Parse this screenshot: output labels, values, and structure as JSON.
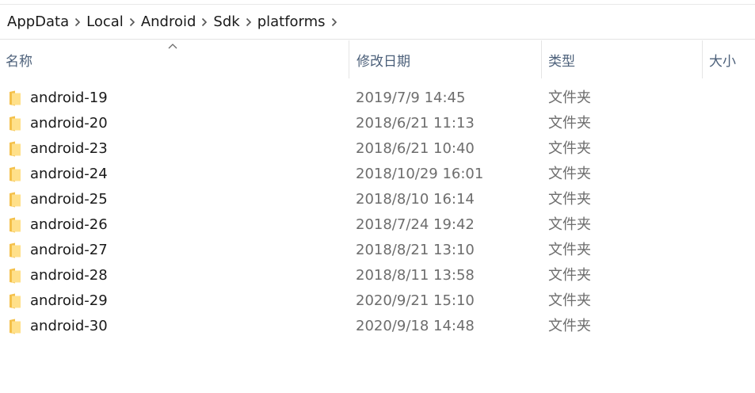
{
  "breadcrumb": {
    "items": [
      "AppData",
      "Local",
      "Android",
      "Sdk",
      "platforms"
    ],
    "separator_icon": "chevron-right-icon"
  },
  "columns": {
    "name": "名称",
    "date": "修改日期",
    "type": "类型",
    "size": "大小",
    "sort_indicator_icon": "sort-ascending-icon"
  },
  "files": [
    {
      "name": "android-19",
      "date": "2019/7/9 14:45",
      "type": "文件夹"
    },
    {
      "name": "android-20",
      "date": "2018/6/21 11:13",
      "type": "文件夹"
    },
    {
      "name": "android-23",
      "date": "2018/6/21 10:40",
      "type": "文件夹"
    },
    {
      "name": "android-24",
      "date": "2018/10/29 16:01",
      "type": "文件夹"
    },
    {
      "name": "android-25",
      "date": "2018/8/10 16:14",
      "type": "文件夹"
    },
    {
      "name": "android-26",
      "date": "2018/7/24 19:42",
      "type": "文件夹"
    },
    {
      "name": "android-27",
      "date": "2018/8/21 13:10",
      "type": "文件夹"
    },
    {
      "name": "android-28",
      "date": "2018/8/11 13:58",
      "type": "文件夹"
    },
    {
      "name": "android-29",
      "date": "2020/9/21 15:10",
      "type": "文件夹"
    },
    {
      "name": "android-30",
      "date": "2020/9/18 14:48",
      "type": "文件夹"
    }
  ],
  "colors": {
    "folder_light": "#ffe08a",
    "folder_dark": "#f4c04a",
    "header_text": "#4c607a",
    "meta_text": "#6d6d6d"
  }
}
